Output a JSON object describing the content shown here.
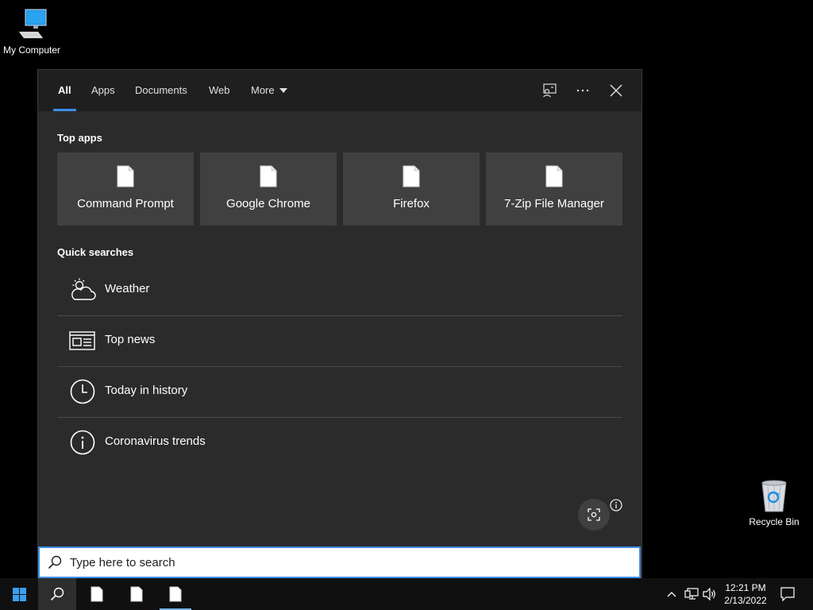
{
  "desktop": {
    "my_computer_label": "My Computer",
    "recycle_bin_label": "Recycle Bin"
  },
  "search_panel": {
    "tabs": [
      {
        "label": "All",
        "active": true
      },
      {
        "label": "Apps"
      },
      {
        "label": "Documents"
      },
      {
        "label": "Web"
      },
      {
        "label": "More"
      }
    ],
    "top_apps_title": "Top apps",
    "top_apps": [
      {
        "label": "Command Prompt",
        "icon": "document-icon"
      },
      {
        "label": "Google Chrome",
        "icon": "document-icon"
      },
      {
        "label": "Firefox",
        "icon": "document-icon"
      },
      {
        "label": "7-Zip File Manager",
        "icon": "document-icon"
      }
    ],
    "quick_searches_title": "Quick searches",
    "quick_searches": [
      {
        "label": "Weather",
        "icon": "weather-icon"
      },
      {
        "label": "Top news",
        "icon": "news-icon"
      },
      {
        "label": "Today in history",
        "icon": "clock-icon"
      },
      {
        "label": "Coronavirus trends",
        "icon": "info-icon"
      }
    ]
  },
  "search_box": {
    "placeholder": "Type here to search"
  },
  "taskbar": {
    "time": "12:21 PM",
    "date": "2/13/2022"
  },
  "colors": {
    "accent": "#3d8ee6",
    "panel_bg": "#2b2b2b",
    "tab_bar_bg": "#1f1f1f",
    "tile_bg": "#404040"
  }
}
